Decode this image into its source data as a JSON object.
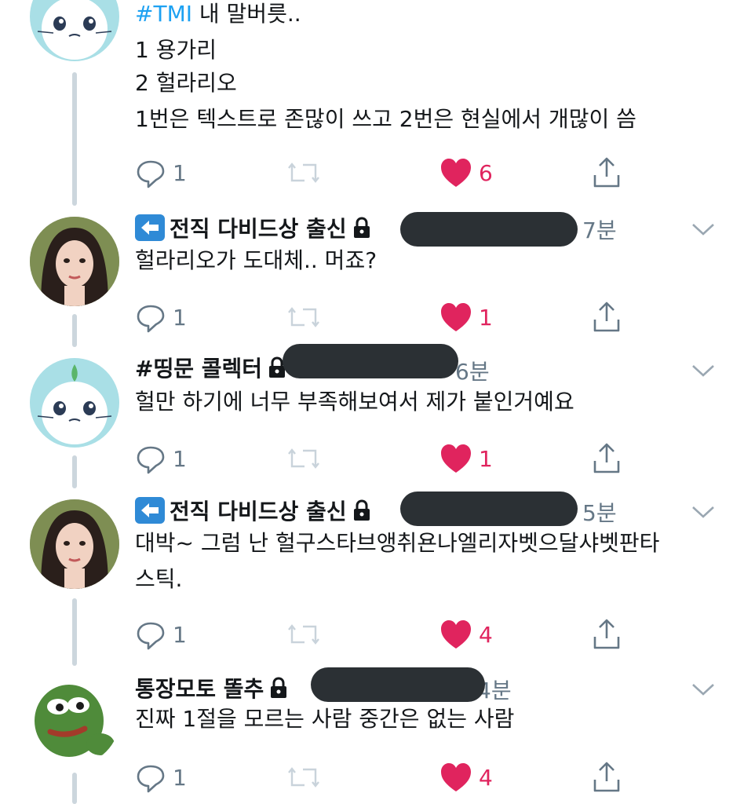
{
  "tweets": [
    {
      "avatar": "cat-avatar",
      "hashtag": "#TMI",
      "line1_rest": " 내 말버릇..",
      "lines": [
        "1 용가리",
        "2 헐라리오",
        "1번은 텍스트로 존많이 쓰고 2번은 현실에서 개많이 씀"
      ],
      "replies": "1",
      "likes": "6"
    },
    {
      "avatar": "woman-avatar",
      "emoji": "back-arrow-emoji",
      "name": "전직 다비드상 출신",
      "time": "7분",
      "text": "헐라리오가 도대체.. 머죠?",
      "replies": "1",
      "likes": "1"
    },
    {
      "avatar": "cat-avatar",
      "name": "#띵문 콜렉터",
      "time": "6분",
      "text": "헐만 하기에 너무 부족해보여서 제가 붙인거예요",
      "replies": "1",
      "likes": "1"
    },
    {
      "avatar": "woman-avatar",
      "emoji": "back-arrow-emoji",
      "name": "전직 다비드상 출신",
      "time": "5분",
      "text_lines": [
        "대박~ 그럼 난 헐구스타브앵취욘나엘리자벳으달샤벳판타",
        "스틱."
      ],
      "replies": "1",
      "likes": "4"
    },
    {
      "avatar": "frog-avatar",
      "name": "통장모토 똘추",
      "time": "4분",
      "text": "진짜 1절을 모르는 사람 중간은 없는 사람",
      "replies": "1",
      "likes": "4"
    }
  ],
  "colors": {
    "like": "#e0245e",
    "muted": "#657786",
    "hashtag": "#1da1f2",
    "thread": "#ccd6dd"
  },
  "icons": [
    "reply-icon",
    "retweet-icon",
    "heart-icon",
    "share-icon",
    "lock-icon",
    "chevron-down-icon"
  ]
}
